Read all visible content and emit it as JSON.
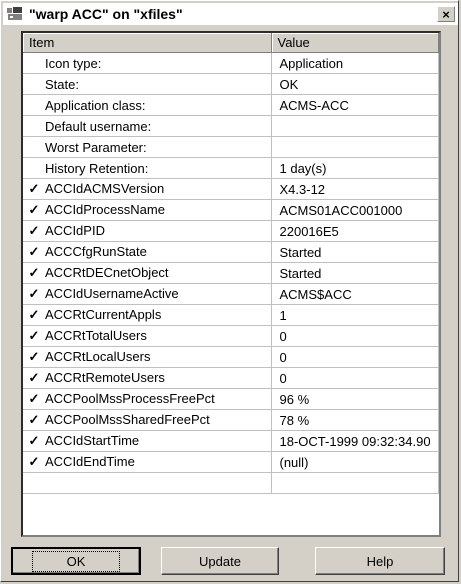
{
  "window": {
    "title": "\"warp ACC\" on \"xfiles\"",
    "close_label": "×"
  },
  "columns": {
    "item": "Item",
    "value": "Value"
  },
  "rows": [
    {
      "checked": false,
      "item": "Icon type:",
      "value": "Application"
    },
    {
      "checked": false,
      "item": "State:",
      "value": "OK"
    },
    {
      "checked": false,
      "item": "Application class:",
      "value": "ACMS-ACC"
    },
    {
      "checked": false,
      "item": "Default username:",
      "value": ""
    },
    {
      "checked": false,
      "item": "Worst Parameter:",
      "value": ""
    },
    {
      "checked": false,
      "item": "History Retention:",
      "value": "1 day(s)"
    },
    {
      "checked": true,
      "item": "ACCIdACMSVersion",
      "value": "X4.3-12"
    },
    {
      "checked": true,
      "item": "ACCIdProcessName",
      "value": "ACMS01ACC001000"
    },
    {
      "checked": true,
      "item": "ACCIdPID",
      "value": "220016E5"
    },
    {
      "checked": true,
      "item": "ACCCfgRunState",
      "value": "Started"
    },
    {
      "checked": true,
      "item": "ACCRtDECnetObject",
      "value": "Started"
    },
    {
      "checked": true,
      "item": "ACCIdUsernameActive",
      "value": "ACMS$ACC"
    },
    {
      "checked": true,
      "item": "ACCRtCurrentAppls",
      "value": "1"
    },
    {
      "checked": true,
      "item": "ACCRtTotalUsers",
      "value": "0"
    },
    {
      "checked": true,
      "item": "ACCRtLocalUsers",
      "value": "0"
    },
    {
      "checked": true,
      "item": "ACCRtRemoteUsers",
      "value": "0"
    },
    {
      "checked": true,
      "item": "ACCPoolMssProcessFreePct",
      "value": "96 %"
    },
    {
      "checked": true,
      "item": "ACCPoolMssSharedFreePct",
      "value": "78 %"
    },
    {
      "checked": true,
      "item": "ACCIdStartTime",
      "value": "18-OCT-1999 09:32:34.90"
    },
    {
      "checked": true,
      "item": "ACCIdEndTime",
      "value": "(null)"
    }
  ],
  "check_glyph": "✓",
  "buttons": {
    "ok": "OK",
    "update": "Update",
    "help": "Help"
  }
}
